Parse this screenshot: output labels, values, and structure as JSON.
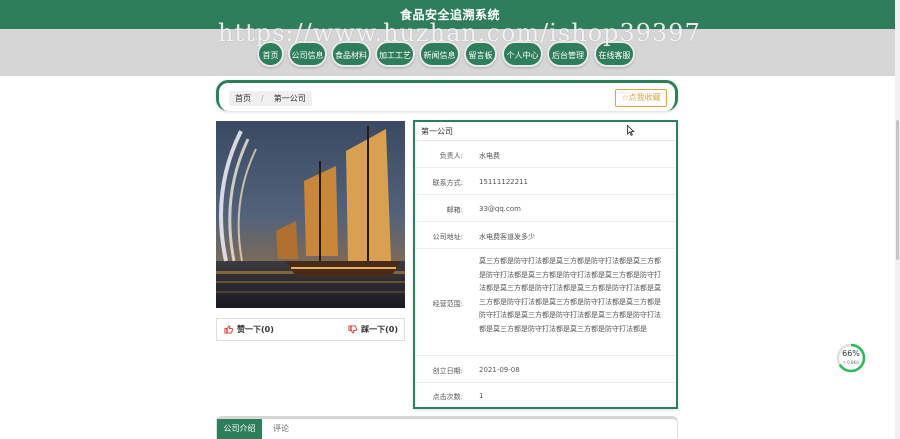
{
  "header": {
    "title": "食品安全追溯系统"
  },
  "watermark": "https://www.huzhan.com/ishop39397",
  "nav": {
    "items": [
      {
        "label": "首页"
      },
      {
        "label": "公司信息"
      },
      {
        "label": "食品材料"
      },
      {
        "label": "加工工艺"
      },
      {
        "label": "新闻信息"
      },
      {
        "label": "留言板"
      },
      {
        "label": "个人中心"
      },
      {
        "label": "后台管理"
      },
      {
        "label": "在线客服"
      }
    ]
  },
  "breadcrumb": {
    "home": "首页",
    "separator": "/",
    "current": "第一公司"
  },
  "collect_button": "☆点我收藏",
  "reactions": {
    "like_label": "赞一下(0)",
    "dislike_label": "踩一下(0)"
  },
  "company": {
    "name": "第一公司",
    "fields": [
      {
        "label": "负责人:",
        "value": "水电费"
      },
      {
        "label": "联系方式:",
        "value": "15111122211"
      },
      {
        "label": "邮箱:",
        "value": "33@qq.com"
      },
      {
        "label": "公司地址:",
        "value": "水电费客道发多少"
      },
      {
        "label": "经营范围:",
        "value": "莫三方都是防守打法都是莫三方都是防守打法都是莫三方都是防守打法都是莫三方都是防守打法都是莫三方都是防守打法都是莫三方都是防守打法都是莫三方都是防守打法都是莫三方都是防守打法都是莫三方都是防守打法都是莫三方都是防守打法都是莫三方都是防守打法都是莫三方都是防守打法都是莫三方都是防守打法都是莫三方都是防守打法都是"
      },
      {
        "label": "创立日期:",
        "value": "2021-09-08"
      },
      {
        "label": "点击次数:",
        "value": "1"
      }
    ]
  },
  "tabs": [
    {
      "label": "公司介绍"
    },
    {
      "label": "评论"
    }
  ],
  "gauge": {
    "percent": "66%",
    "sub": "↑ 0.6K/s"
  },
  "colors": {
    "primary": "#2e7d5b",
    "accent": "#d9a646"
  }
}
